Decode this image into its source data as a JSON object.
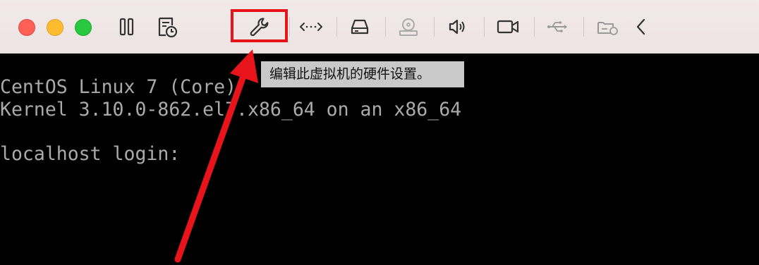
{
  "toolbar": {
    "buttons": [
      {
        "name": "pause",
        "icon": "pause-icon"
      },
      {
        "name": "snapshot",
        "icon": "snapshot-clock-icon"
      },
      {
        "name": "settings",
        "icon": "wrench-icon"
      },
      {
        "name": "network",
        "icon": "network-arrows-icon"
      },
      {
        "name": "hard-disk",
        "icon": "hard-disk-icon"
      },
      {
        "name": "optical-drive",
        "icon": "optical-drive-icon"
      },
      {
        "name": "sound",
        "icon": "speaker-icon"
      },
      {
        "name": "camera",
        "icon": "camera-icon"
      },
      {
        "name": "usb",
        "icon": "usb-icon"
      },
      {
        "name": "shared-folder",
        "icon": "shared-folder-icon"
      },
      {
        "name": "collapse",
        "icon": "chevron-left-icon"
      }
    ]
  },
  "tooltip": {
    "text": "编辑此虚拟机的硬件设置。"
  },
  "console": {
    "lines": [
      "CentOS Linux 7 (Core)",
      "Kernel 3.10.0-862.el7.x86_64 on an x86_64",
      "",
      "localhost login: "
    ]
  },
  "colors": {
    "highlight": "#e8141c",
    "console_text": "#aaaaaa",
    "console_bg": "#000000",
    "toolbar_bg": "#f0e7e7",
    "tooltip_bg": "#c9c9c9"
  }
}
